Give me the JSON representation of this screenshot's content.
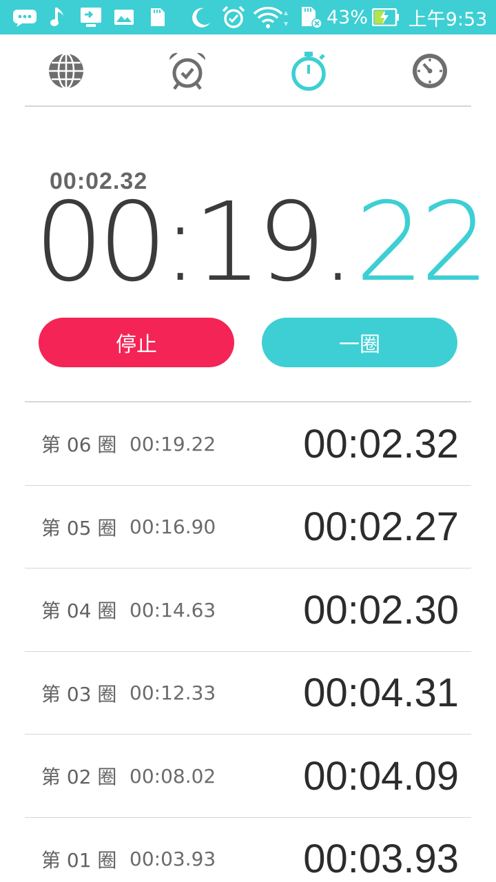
{
  "status_bar": {
    "battery_percent": "43%",
    "time": "上午9:53",
    "icons": [
      "message-icon",
      "music-icon",
      "screen-cast-icon",
      "gallery-icon",
      "sd-card-icon",
      "moon-icon",
      "alarm-icon",
      "wifi-icon",
      "sd-card-error-icon",
      "battery-charging-icon"
    ],
    "bg_color": "#3dcfd3"
  },
  "tabs": [
    {
      "name": "world-clock",
      "icon": "globe-icon",
      "active": false
    },
    {
      "name": "alarm",
      "icon": "alarm-clock-icon",
      "active": false
    },
    {
      "name": "stopwatch",
      "icon": "stopwatch-icon",
      "active": true
    },
    {
      "name": "timer",
      "icon": "timer-dial-icon",
      "active": false
    }
  ],
  "timer": {
    "current_lap": "00:02.32",
    "main_minutes_seconds": "00:19",
    "dot": ".",
    "centiseconds": "22"
  },
  "buttons": {
    "stop_label": "停止",
    "lap_label": "一圈"
  },
  "laps": [
    {
      "label": "第 06 圈",
      "total": "00:19.22",
      "split": "00:02.32"
    },
    {
      "label": "第 05 圈",
      "total": "00:16.90",
      "split": "00:02.27"
    },
    {
      "label": "第 04 圈",
      "total": "00:14.63",
      "split": "00:02.30"
    },
    {
      "label": "第 03 圈",
      "total": "00:12.33",
      "split": "00:04.31"
    },
    {
      "label": "第 02 圈",
      "total": "00:08.02",
      "split": "00:04.09"
    },
    {
      "label": "第 01 圈",
      "total": "00:03.93",
      "split": "00:03.93"
    }
  ],
  "colors": {
    "accent": "#3dcfd3",
    "stop": "#f42456",
    "icon_gray": "#6e6e6e"
  }
}
